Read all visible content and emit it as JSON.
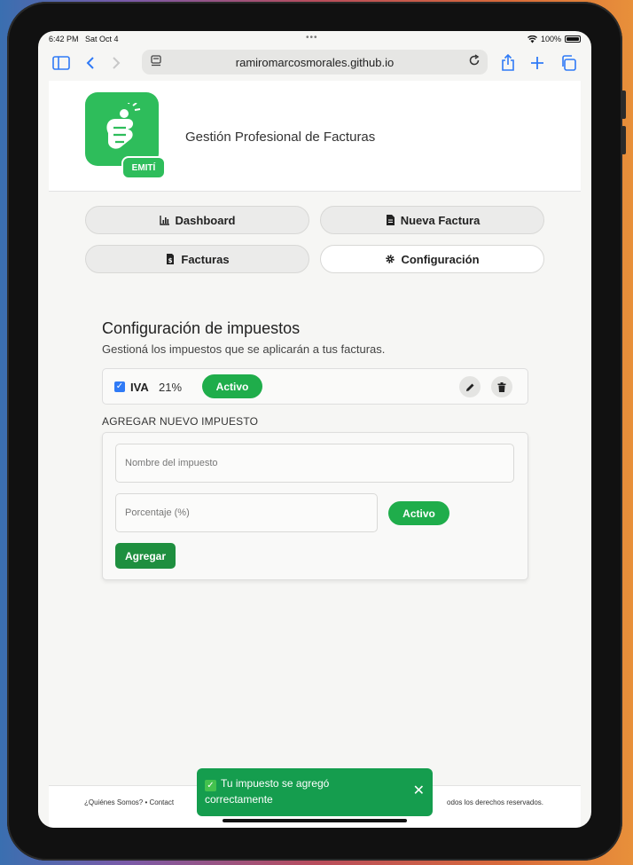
{
  "status_bar": {
    "time": "6:42 PM",
    "date": "Sat Oct 4",
    "battery": "100%"
  },
  "browser": {
    "url": "ramiromarcosmorales.github.io"
  },
  "brand": {
    "badge": "EMITÍ",
    "title": "Gestión Profesional de Facturas"
  },
  "nav": {
    "dashboard": "Dashboard",
    "nueva_factura": "Nueva Factura",
    "facturas": "Facturas",
    "configuracion": "Configuración"
  },
  "section": {
    "title": "Configuración de impuestos",
    "subtitle": "Gestioná los impuestos que se aplicarán a tus facturas."
  },
  "taxes": [
    {
      "name": "IVA",
      "rate": "21%",
      "status": "Activo",
      "checked": true
    }
  ],
  "add_tax": {
    "label": "AGREGAR NUEVO IMPUESTO",
    "name_placeholder": "Nombre del impuesto",
    "rate_placeholder": "Porcentaje (%)",
    "status_toggle": "Activo",
    "submit": "Agregar"
  },
  "footer": {
    "left": "¿Quiénes Somos?   •   Contact",
    "right": "odos los derechos reservados."
  },
  "toast": {
    "message_line1": "Tu impuesto se agregó",
    "message_line2": "correctamente"
  },
  "colors": {
    "accent": "#2ebd5b",
    "button_green": "#1fad4b",
    "toast": "#159d4e",
    "link_blue": "#2f7af6"
  }
}
